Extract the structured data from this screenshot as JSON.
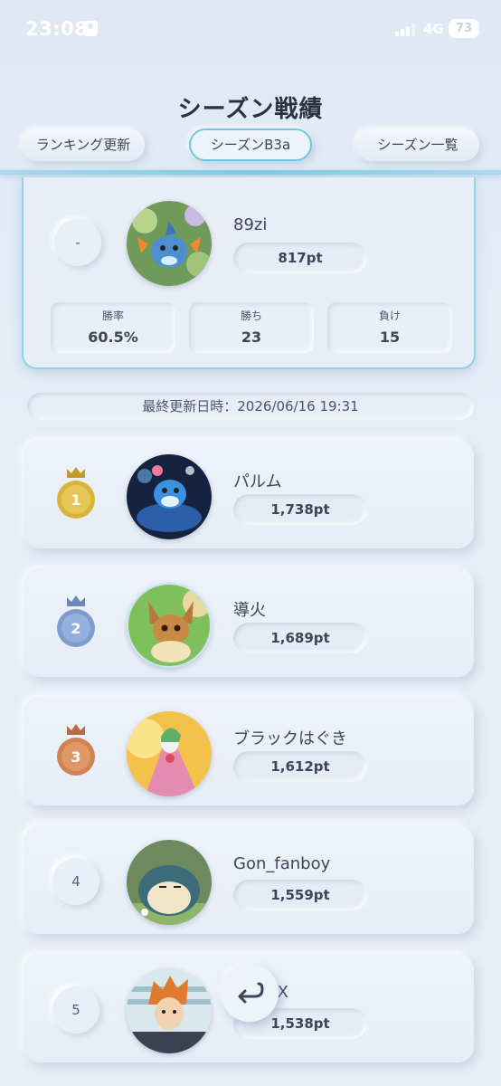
{
  "status_bar": {
    "time": "23:08",
    "network": "4G",
    "battery": "73"
  },
  "header": {
    "title": "シーズン戦績",
    "ranking_button": "ランキング更新",
    "season_button": "シーズンB3a",
    "season_list_button": "シーズン一覧"
  },
  "my_record": {
    "rank": "-",
    "name": "89zi",
    "points": "817pt",
    "stats": [
      {
        "label": "勝率",
        "value": "60.5%"
      },
      {
        "label": "勝ち",
        "value": "23"
      },
      {
        "label": "負け",
        "value": "15"
      }
    ]
  },
  "last_updated": "最終更新日時：2026/06/16 19:31",
  "rankings": [
    {
      "rank": "1",
      "name": "パルム",
      "points": "1,738pt"
    },
    {
      "rank": "2",
      "name": "導火",
      "points": "1,689pt"
    },
    {
      "rank": "3",
      "name": "ブラックはぐき",
      "points": "1,612pt"
    },
    {
      "rank": "4",
      "name": "Gon_fanboy",
      "points": "1,559pt"
    },
    {
      "rank": "5",
      "name": "DogXX",
      "points": "1,538pt"
    }
  ],
  "colors": {
    "accent": "#7fcbe4",
    "gold": "#d8b43a",
    "silver": "#7f9ccc",
    "bronze": "#cf8354"
  }
}
